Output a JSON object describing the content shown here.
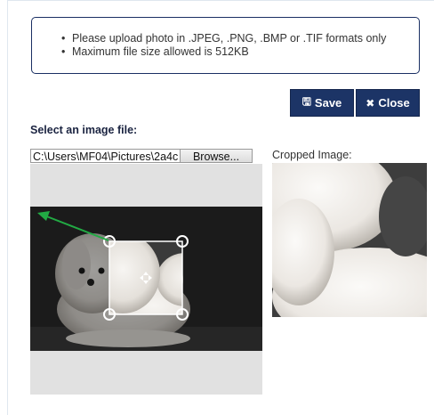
{
  "notice": {
    "items": [
      "Please upload photo in .JPEG, .PNG, .BMP or .TIF formats only",
      "Maximum file size allowed is 512KB"
    ]
  },
  "toolbar": {
    "save_label": "Save",
    "save_icon": "floppy-disk-icon",
    "close_label": "Close",
    "close_icon": "x-icon"
  },
  "upload": {
    "label": "Select an image file:",
    "file_path": "C:\\Users\\MF04\\Pictures\\2a4c",
    "browse_label": "Browse..."
  },
  "preview": {
    "label": "Cropped Image:"
  },
  "colors": {
    "button_bg": "#1c3466",
    "notice_border": "#1a2f63",
    "arrow": "#22aa44"
  }
}
